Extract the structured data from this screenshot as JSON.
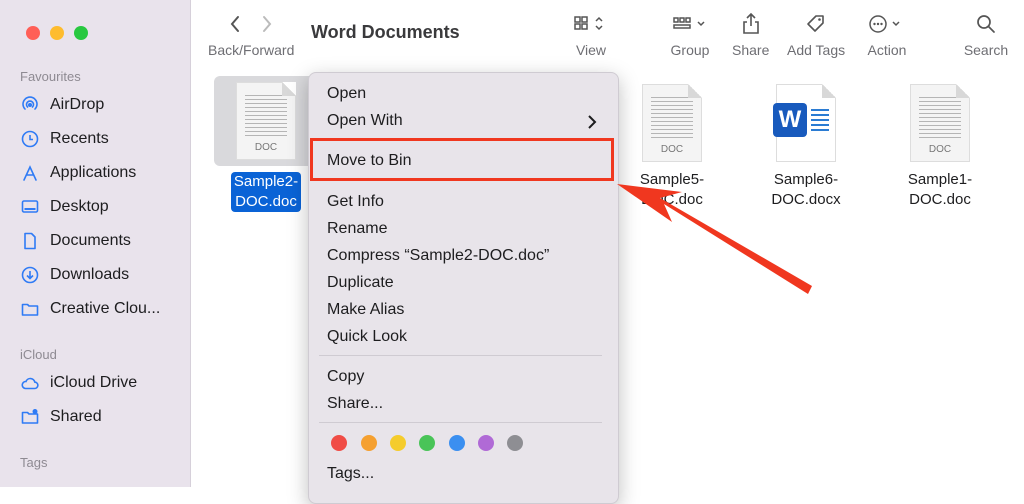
{
  "window": {
    "title": "Word Documents"
  },
  "toolbar": {
    "back_forward": "Back/Forward",
    "view": "View",
    "group": "Group",
    "share": "Share",
    "add_tags": "Add Tags",
    "action": "Action",
    "search": "Search"
  },
  "sidebar": {
    "favourites_heading": "Favourites",
    "favourites": [
      "AirDrop",
      "Recents",
      "Applications",
      "Desktop",
      "Documents",
      "Downloads",
      "Creative Clou..."
    ],
    "icloud_heading": "iCloud",
    "icloud": [
      "iCloud Drive",
      "Shared"
    ],
    "tags_heading": "Tags"
  },
  "files": [
    {
      "name_line1": "Sample2-",
      "name_line2": "DOC.doc",
      "thumb_label": "DOC",
      "selected": true
    },
    {
      "name_line1": "Sample5-",
      "name_line2": "DOC.doc",
      "thumb_label": "DOC"
    },
    {
      "name_line1": "Sample6-",
      "name_line2": "DOC.docx",
      "thumb_label": "W"
    },
    {
      "name_line1": "Sample1-",
      "name_line2": "DOC.doc",
      "thumb_label": "DOC"
    }
  ],
  "context_menu": {
    "open": "Open",
    "open_with": "Open With",
    "move_to_bin": "Move to Bin",
    "get_info": "Get Info",
    "rename": "Rename",
    "compress": "Compress “Sample2-DOC.doc”",
    "duplicate": "Duplicate",
    "make_alias": "Make Alias",
    "quick_look": "Quick Look",
    "copy": "Copy",
    "share": "Share...",
    "tags": "Tags..."
  },
  "colors": {
    "accent": "#0a63d6",
    "highlight": "#f0371f",
    "tag_colors": [
      "#f04c46",
      "#f5a030",
      "#f5cc2c",
      "#49c458",
      "#3b8ff0",
      "#b06ad6",
      "#8e8e93"
    ]
  }
}
